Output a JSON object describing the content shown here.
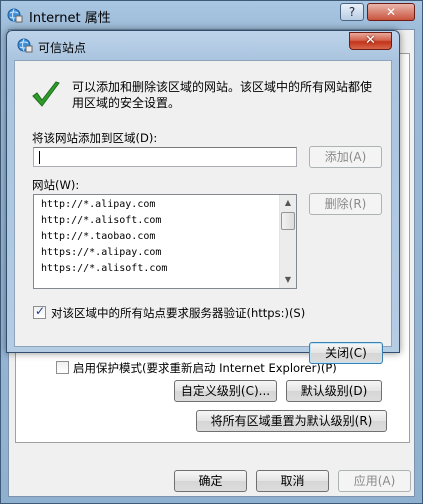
{
  "parent": {
    "title": "Internet 属性",
    "help_label": "?",
    "close_label": "✕",
    "protected_mode_label": "启用保护模式(要求重新启动 Internet Explorer)(P)",
    "custom_level_label": "自定义级别(C)...",
    "default_level_label": "默认级别(D)",
    "reset_all_label": "将所有区域重置为默认级别(R)",
    "ok_label": "确定",
    "cancel_label": "取消",
    "apply_label": "应用(A)"
  },
  "dialog": {
    "title": "可信站点",
    "close_label": "✕",
    "info_text_line1": "可以添加和删除该区域的网站。该区域中的所有网站都使",
    "info_text_line2": "用区域的安全设置。",
    "add_label": "将该网站添加到区域(D):",
    "add_input_value": "",
    "add_button": "添加(A)",
    "websites_label": "网站(W):",
    "websites": [
      "http://*.alipay.com",
      "http://*.alisoft.com",
      "http://*.taobao.com",
      "https://*.alipay.com",
      "https://*.alisoft.com"
    ],
    "remove_button": "删除(R)",
    "require_https_label": "对该区域中的所有站点要求服务器验证(https:)(S)",
    "require_https_checked": true,
    "close_button": "关闭(C)"
  },
  "colors": {
    "check_green": "#2f9b2b",
    "title_bar": "#aac4df",
    "close_red": "#c2341a"
  },
  "icons": {
    "parent_title": "globe-settings-icon",
    "dialog_title": "globe-settings-icon",
    "info": "green-checkmark-icon"
  }
}
